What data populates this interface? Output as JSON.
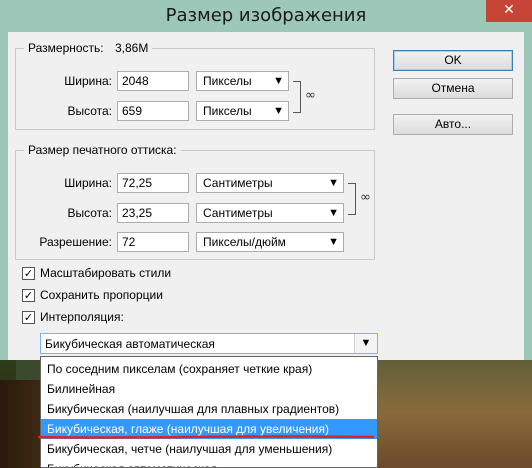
{
  "window": {
    "title": "Размер изображения",
    "close_label": "✕"
  },
  "pixel_dimensions": {
    "label": "Размерность:",
    "value": "3,86M",
    "width_label": "Ширина:",
    "width_value": "2048",
    "width_unit": "Пикселы",
    "height_label": "Высота:",
    "height_value": "659",
    "height_unit": "Пикселы"
  },
  "document_size": {
    "label": "Размер печатного оттиска:",
    "width_label": "Ширина:",
    "width_value": "72,25",
    "width_unit": "Сантиметры",
    "height_label": "Высота:",
    "height_value": "23,25",
    "height_unit": "Сантиметры",
    "resolution_label": "Разрешение:",
    "resolution_value": "72",
    "resolution_unit": "Пикселы/дюйм"
  },
  "buttons": {
    "ok": "OK",
    "cancel": "Отмена",
    "auto": "Авто..."
  },
  "options": {
    "scale_styles": {
      "label": "Масштабировать стили",
      "checked": true
    },
    "constrain": {
      "label": "Сохранить пропорции",
      "checked": true
    },
    "resample": {
      "label": "Интерполяция:",
      "checked": true
    }
  },
  "resample_method": {
    "selected": "Бикубическая автоматическая",
    "items": [
      "По соседним пикселам (сохраняет четкие края)",
      "Билинейная",
      "Бикубическая (наилучшая для плавных градиентов)",
      "Бикубическая, глаже (наилучшая для увеличения)",
      "Бикубическая, четче (наилучшая для уменьшения)",
      "Бикубическая автоматическая"
    ],
    "highlighted_index": 3
  },
  "colors": {
    "title_bar": "#9cc7b9",
    "highlight": "#3399ff",
    "annotation": "#e0202a"
  },
  "icons": {
    "link": "chain-link-icon",
    "dropdown": "chevron-down-icon",
    "check": "checkmark-icon"
  }
}
